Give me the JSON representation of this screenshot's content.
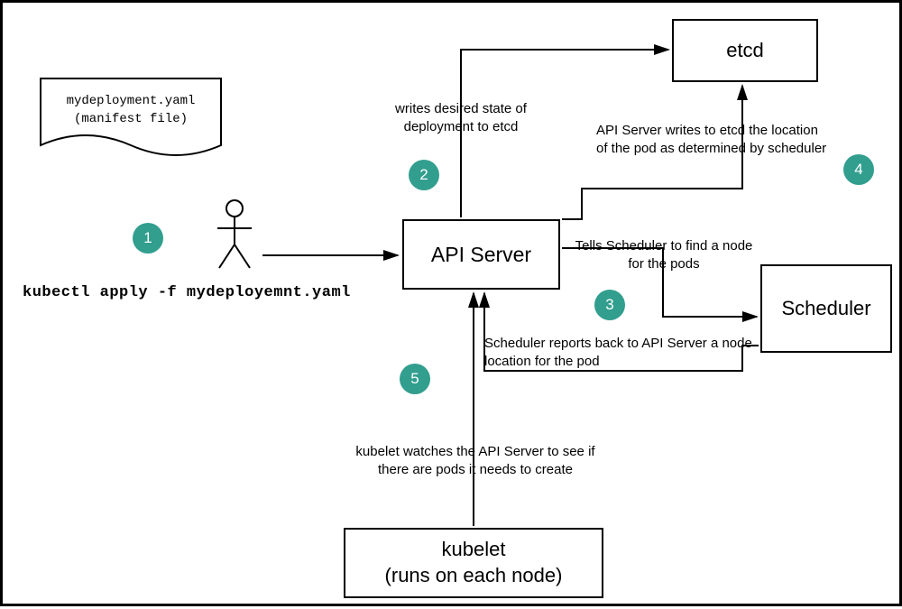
{
  "boxes": {
    "api_server": "API Server",
    "etcd": "etcd",
    "scheduler": "Scheduler",
    "kubelet_line1": "kubelet",
    "kubelet_line2": "(runs on each node)"
  },
  "manifest": {
    "filename": "mydeployment.yaml",
    "caption": "(manifest file)"
  },
  "command": "kubectl apply -f  mydeployemnt.yaml",
  "steps": {
    "s1": "1",
    "s2": "2",
    "s3": "3",
    "s4": "4",
    "s5": "5"
  },
  "labels": {
    "write_state": "writes desired state of deployment to etcd",
    "tells_scheduler": "Tells Scheduler to find a node for the pods",
    "writes_location": "API Server writes to etcd the location of the pod as determined by scheduler",
    "scheduler_reports": "Scheduler reports back to API Server a node location for the pod",
    "kubelet_watches": "kubelet watches the API Server to see if there are pods it needs to create"
  },
  "colors": {
    "badge": "#319e8e"
  }
}
